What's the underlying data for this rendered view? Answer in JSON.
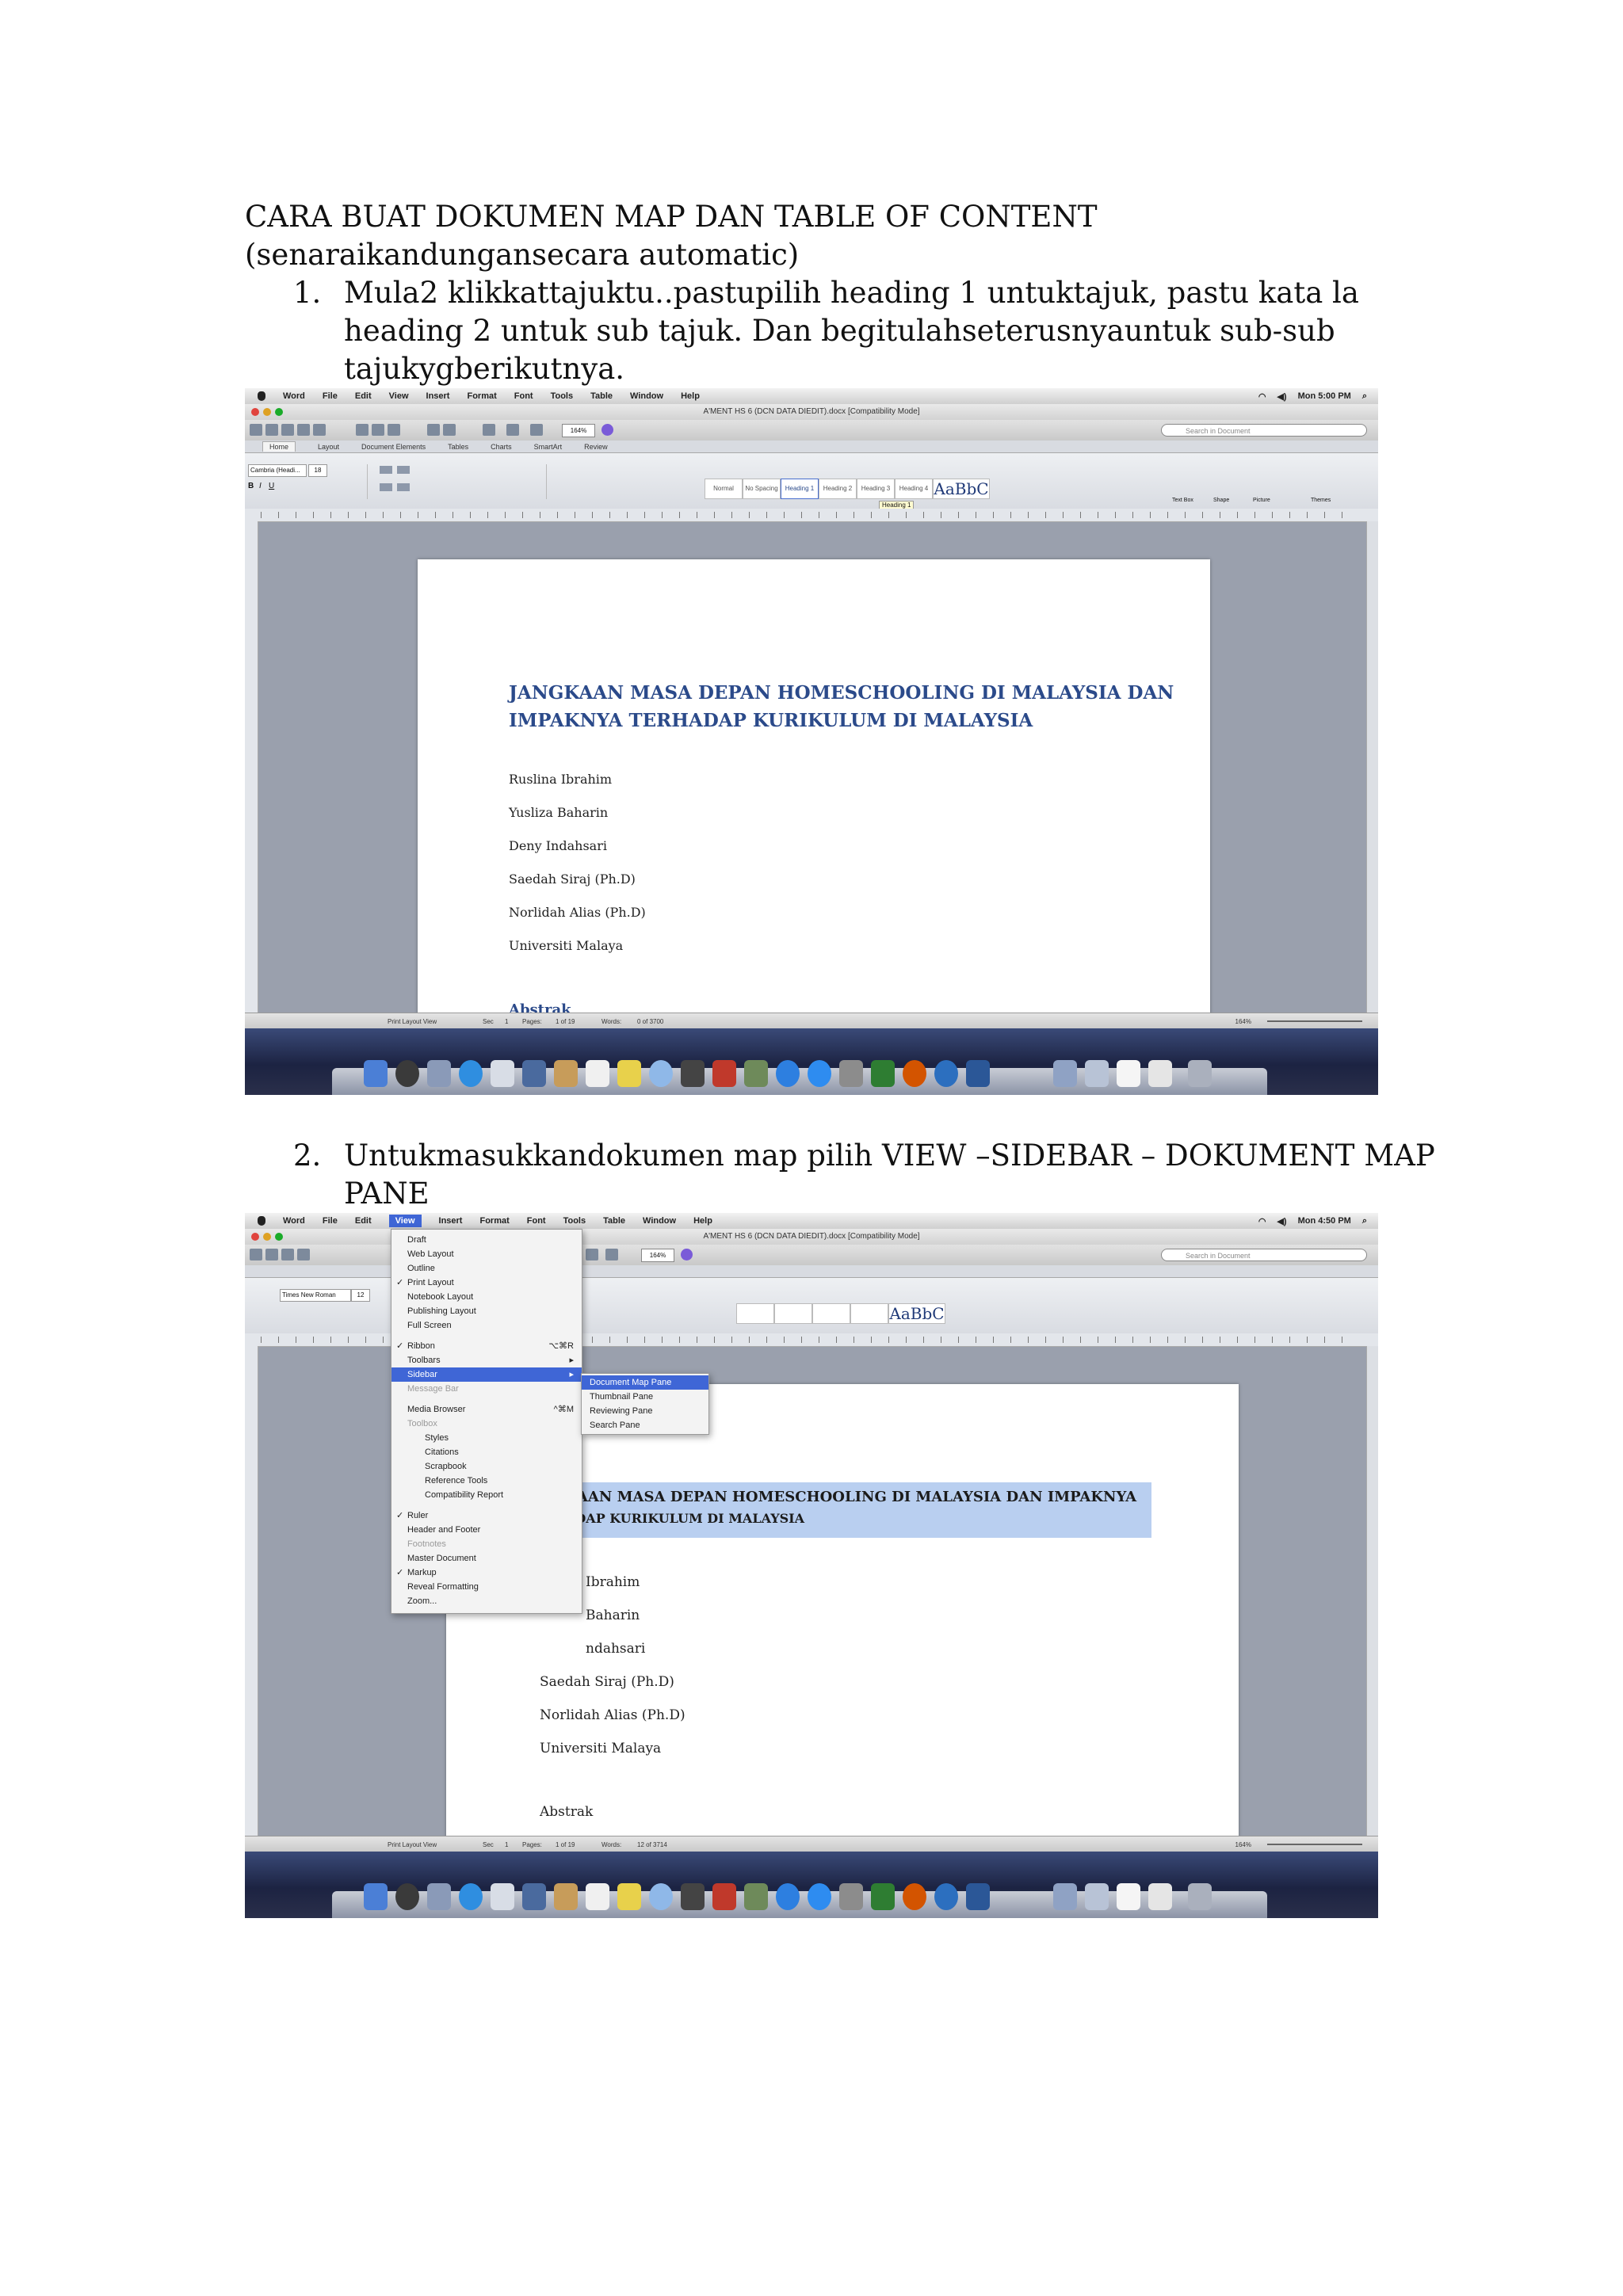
{
  "heading_line1": "CARA BUAT DOKUMEN MAP DAN TABLE OF CONTENT",
  "heading_line2": "(senaraikandungansecara automatic)",
  "steps": [
    {
      "num": "1.",
      "lines": [
        "Mula2 klikkattajuktu..pastupilih heading 1 untuktajuk, pastu kata la",
        "heading 2 untuk sub tajuk. Dan begitulahseterusnyauntuk sub-sub",
        "tajukygberikutnya."
      ]
    },
    {
      "num": "2.",
      "lines": [
        "Untukmasukkandokumen map pilih VIEW –SIDEBAR – DOKUMENT MAP",
        "PANE"
      ]
    }
  ],
  "shot1": {
    "menubar": [
      "Word",
      "File",
      "Edit",
      "View",
      "Insert",
      "Format",
      "Font",
      "Tools",
      "Table",
      "Window",
      "Help"
    ],
    "clock": "Mon 5:00 PM",
    "window_title": "A'MENT HS 6 (DCN DATA DIEDIT).docx [Compatibility Mode]",
    "search_placeholder": "Search in Document",
    "tabs": [
      "Home",
      "Layout",
      "Document Elements",
      "Tables",
      "Charts",
      "SmartArt",
      "Review"
    ],
    "font_name": "Cambria (Headi...",
    "font_size": "18",
    "zoom": "164%",
    "styles": [
      "Normal",
      "No Spacing",
      "Heading 1",
      "Heading 2",
      "Heading 3",
      "Heading 4",
      "Title"
    ],
    "style_preview_big": "AaBbC",
    "heading_tooltip": "Heading 1",
    "ribbon_right": [
      "Text Box",
      "Shape",
      "Picture",
      "Themes"
    ],
    "page_title_line1": "JANGKAAN MASA DEPAN HOMESCHOOLING DI MALAYSIA DAN",
    "page_title_line2": "IMPAKNYA TERHADAP KURIKULUM DI MALAYSIA",
    "authors": [
      "Ruslina Ibrahim",
      "Yusliza Baharin",
      "Deny Indahsari",
      "Saedah Siraj (Ph.D)",
      "Norlidah Alias (Ph.D)",
      "Universiti Malaya"
    ],
    "next_heading": "Abstrak",
    "status": {
      "view": "Print Layout View",
      "sec": "Sec",
      "sec_val": "1",
      "pages": "Pages:",
      "pages_val": "1 of 19",
      "words": "Words:",
      "words_val": "0 of 3700",
      "zoom": "164%"
    }
  },
  "shot2": {
    "menubar": [
      "Word",
      "File",
      "Edit",
      "View",
      "Insert",
      "Format",
      "Font",
      "Tools",
      "Table",
      "Window",
      "Help"
    ],
    "clock": "Mon 4:50 PM",
    "window_title": "A'MENT HS 6 (DCN DATA DIEDIT).docx [Compatibility Mode]",
    "search_placeholder": "Search in Document",
    "font_name": "Times New Roman",
    "font_size": "12",
    "zoom": "164%",
    "view_menu": [
      {
        "label": "Draft",
        "check": "",
        "shortcut": "",
        "grey": false
      },
      {
        "label": "Web Layout",
        "check": "",
        "shortcut": "",
        "grey": false
      },
      {
        "label": "Outline",
        "check": "",
        "shortcut": "",
        "grey": false
      },
      {
        "label": "Print Layout",
        "check": "✓",
        "shortcut": "",
        "grey": false
      },
      {
        "label": "Notebook Layout",
        "check": "",
        "shortcut": "",
        "grey": false
      },
      {
        "label": "Publishing Layout",
        "check": "",
        "shortcut": "",
        "grey": false
      },
      {
        "label": "Full Screen",
        "check": "",
        "shortcut": "",
        "grey": false
      },
      {
        "label": "Ribbon",
        "check": "✓",
        "shortcut": "⌥⌘R",
        "grey": false
      },
      {
        "label": "Toolbars",
        "check": "",
        "shortcut": "▸",
        "grey": false
      },
      {
        "label": "Sidebar",
        "check": "",
        "shortcut": "▸",
        "grey": false
      },
      {
        "label": "Message Bar",
        "check": "",
        "shortcut": "",
        "grey": true
      },
      {
        "label": "Media Browser",
        "check": "",
        "shortcut": "^⌘M",
        "grey": false
      },
      {
        "label": "Toolbox",
        "check": "",
        "shortcut": "",
        "grey": true
      },
      {
        "label": "Styles",
        "check": "",
        "shortcut": "",
        "grey": false
      },
      {
        "label": "Citations",
        "check": "",
        "shortcut": "",
        "grey": false
      },
      {
        "label": "Scrapbook",
        "check": "",
        "shortcut": "",
        "grey": false
      },
      {
        "label": "Reference Tools",
        "check": "",
        "shortcut": "",
        "grey": false
      },
      {
        "label": "Compatibility Report",
        "check": "",
        "shortcut": "",
        "grey": false
      },
      {
        "label": "Ruler",
        "check": "✓",
        "shortcut": "",
        "grey": false
      },
      {
        "label": "Header and Footer",
        "check": "",
        "shortcut": "",
        "grey": false
      },
      {
        "label": "Footnotes",
        "check": "",
        "shortcut": "",
        "grey": true
      },
      {
        "label": "Master Document",
        "check": "",
        "shortcut": "",
        "grey": false
      },
      {
        "label": "Markup",
        "check": "✓",
        "shortcut": "",
        "grey": false
      },
      {
        "label": "Reveal Formatting",
        "check": "",
        "shortcut": "",
        "grey": false
      },
      {
        "label": "Zoom...",
        "check": "",
        "shortcut": "",
        "grey": false
      }
    ],
    "sidebar_submenu": [
      "Document Map Pane",
      "Thumbnail Pane",
      "Reviewing Pane",
      "Search Pane"
    ],
    "page_title_line1": "KAAN MASA DEPAN HOMESCHOOLING DI MALAYSIA DAN IMPAKNYA",
    "page_title_line2": "ADAP KURIKULUM DI MALAYSIA",
    "authors": [
      "Ibrahim",
      "Baharin",
      "ndahsari",
      "Saedah Siraj (Ph.D)",
      "Norlidah Alias (Ph.D)",
      "Universiti Malaya"
    ],
    "next_heading": "Abstrak",
    "status": {
      "view": "Print Layout View",
      "sec": "Sec",
      "sec_val": "1",
      "pages": "Pages:",
      "pages_val": "1 of 19",
      "words": "Words:",
      "words_val": "12 of 3714",
      "zoom": "164%"
    }
  }
}
